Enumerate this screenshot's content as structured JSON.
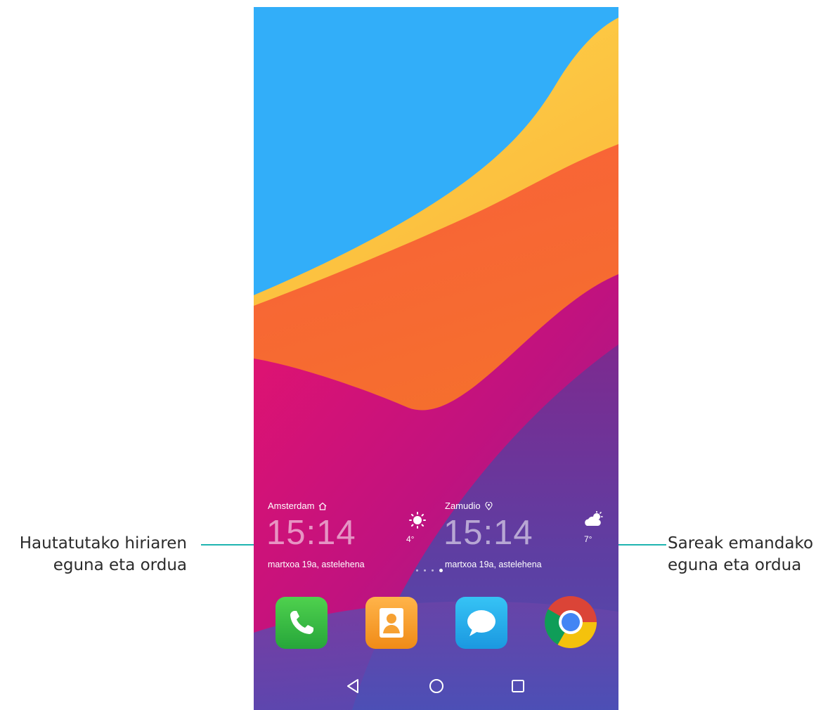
{
  "annotations": {
    "left": {
      "line1": "Hautatutako hiriaren",
      "line2": "eguna eta ordua"
    },
    "right": {
      "line1": "Sareak emandako",
      "line2": "eguna eta ordua"
    },
    "leader_color": "#1fb5b0"
  },
  "home_screen": {
    "wallpaper_colors": {
      "sky": "#32aef9",
      "yellow": "#fcc33a",
      "orange": "#f46a2c",
      "magenta": "#d4127e",
      "purple": "#6a3aa0"
    },
    "clock_home": {
      "city": "Amsterdam",
      "city_icon": "home-icon",
      "time": "15:14",
      "date": "martxoa 19a, astelehena",
      "temperature": "4°",
      "weather_icon": "sun-icon"
    },
    "clock_local": {
      "city": "Zamudio",
      "city_icon": "location-pin-icon",
      "time": "15:14",
      "date": "martxoa 19a, astelehena",
      "temperature": "7°",
      "weather_icon": "partly-cloudy-icon"
    },
    "page_indicator": {
      "pages": 4,
      "current": 4
    },
    "dock": [
      {
        "app": "phone-icon"
      },
      {
        "app": "contacts-icon"
      },
      {
        "app": "messages-icon"
      },
      {
        "app": "chrome-icon"
      }
    ],
    "navigation": [
      "back-icon",
      "home-icon",
      "recents-icon"
    ]
  }
}
